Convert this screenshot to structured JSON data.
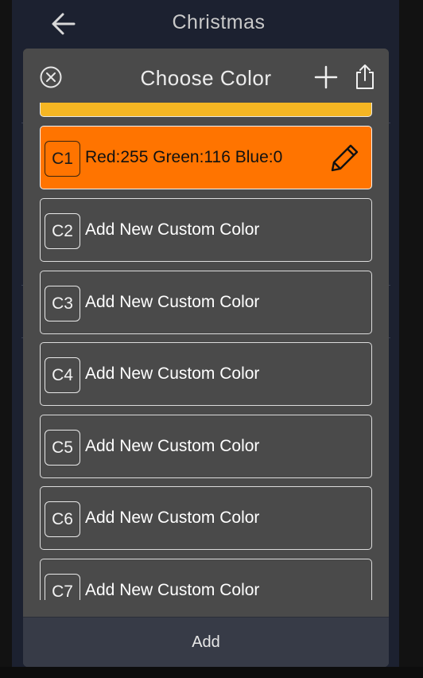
{
  "screen": {
    "title": "Christmas"
  },
  "modal": {
    "title": "Choose Color",
    "icons": {
      "close": "close-circle-icon",
      "add": "plus-icon",
      "share": "share-icon",
      "edit": "pencil-icon"
    },
    "previous_color_hex": "#f5b623",
    "items": [
      {
        "slot": "C1",
        "label": "Red:255 Green:116 Blue:0",
        "active": true,
        "color": "#ff7400"
      },
      {
        "slot": "C2",
        "label": "Add New Custom Color",
        "active": false
      },
      {
        "slot": "C3",
        "label": "Add New Custom Color",
        "active": false
      },
      {
        "slot": "C4",
        "label": "Add New Custom Color",
        "active": false
      },
      {
        "slot": "C5",
        "label": "Add New Custom Color",
        "active": false
      },
      {
        "slot": "C6",
        "label": "Add New Custom Color",
        "active": false
      },
      {
        "slot": "C7",
        "label": "Add New Custom Color",
        "active": false
      }
    ],
    "footer_button": "Add"
  }
}
